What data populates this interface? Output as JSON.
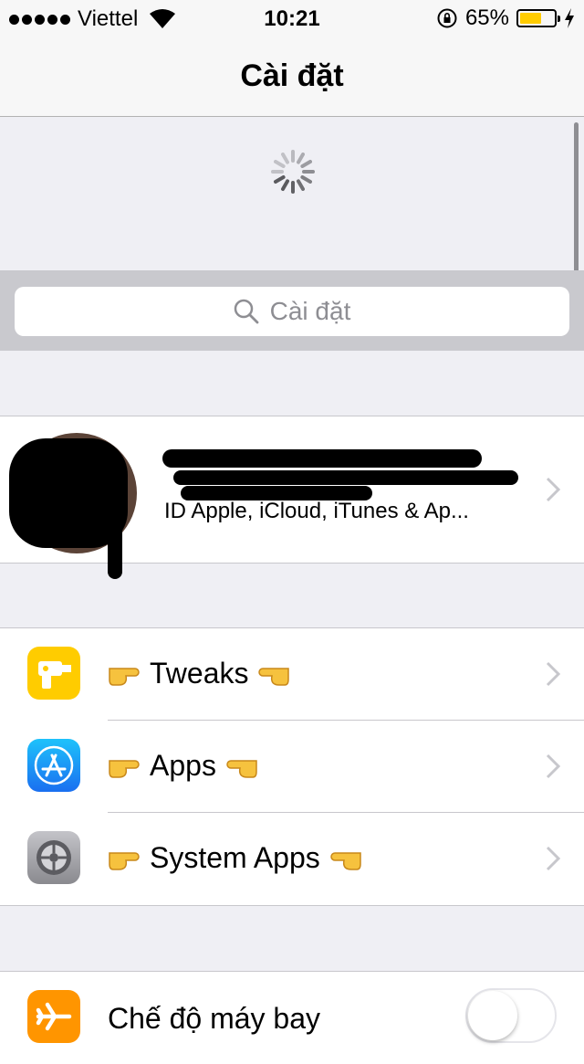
{
  "status_bar": {
    "carrier": "Viettel",
    "time": "10:21",
    "battery_percent": "65%",
    "battery_level": 0.65,
    "signal_bars": 5
  },
  "nav": {
    "title": "Cài đặt"
  },
  "search": {
    "placeholder": "Cài đặt"
  },
  "profile": {
    "subtitle": "ID Apple, iCloud, iTunes & Ap..."
  },
  "menu": [
    {
      "label": "Tweaks",
      "icon": "drill-icon",
      "color": "#ffcc00"
    },
    {
      "label": "Apps",
      "icon": "app-store-icon",
      "color": "#1a8cf5"
    },
    {
      "label": "System Apps",
      "icon": "gear-icon",
      "color": "#8e8e93"
    }
  ],
  "airplane": {
    "label": "Chế độ máy bay",
    "icon": "airplane-icon",
    "color": "#ff9500",
    "enabled": false
  }
}
